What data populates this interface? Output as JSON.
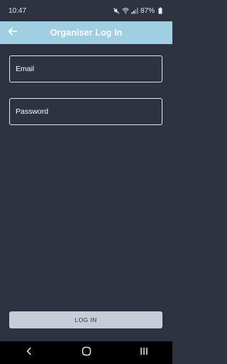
{
  "status_bar": {
    "time": "10:47",
    "battery": "87%",
    "icons": [
      "mute-icon",
      "wifi-icon",
      "signal-icon",
      "battery-icon"
    ]
  },
  "header": {
    "title": "Organiser Log In",
    "back_icon": "arrow-left-icon",
    "background": "#9fcfe1"
  },
  "form": {
    "email_placeholder": "Email",
    "email_value": "",
    "password_placeholder": "Password",
    "password_value": ""
  },
  "login_button": {
    "label": "LOG IN"
  },
  "nav_bar": {
    "icons": [
      "back-chevron-icon",
      "home-circle-icon",
      "recents-icon"
    ]
  },
  "colors": {
    "background": "#2f3240",
    "accent": "#9fcfe1",
    "button": "#c8ccd6"
  }
}
